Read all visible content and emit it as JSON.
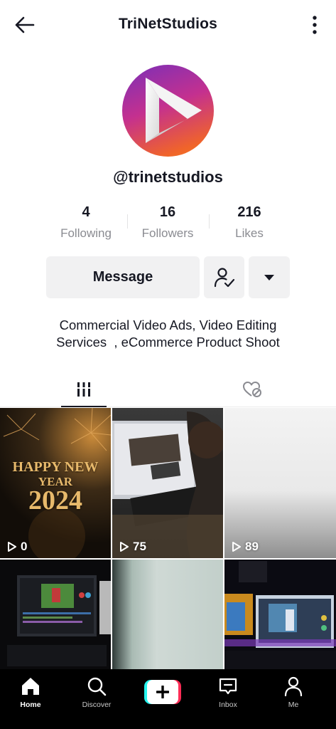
{
  "header": {
    "title": "TriNetStudios",
    "back_icon": "arrow-left-icon",
    "more_icon": "vertical-dots-icon"
  },
  "profile": {
    "handle": "@trinetstudios",
    "avatar_colors": [
      "#7a2fb8",
      "#c4308f",
      "#f0642a"
    ]
  },
  "stats": [
    {
      "value": "4",
      "label": "Following"
    },
    {
      "value": "16",
      "label": "Followers"
    },
    {
      "value": "216",
      "label": "Likes"
    }
  ],
  "actions": {
    "message_label": "Message",
    "follow_icon": "user-check-icon",
    "dropdown_icon": "caret-down-icon"
  },
  "bio": {
    "line1": "Commercial Video Ads, Video Editing",
    "line2": "Services  , eCommerce Product Shoot"
  },
  "tabs": [
    {
      "name": "videos",
      "icon": "grid-bars-icon",
      "active": true
    },
    {
      "name": "liked",
      "icon": "hidden-heart-icon",
      "active": false
    }
  ],
  "videos": [
    {
      "views": "0",
      "overlay_line1": "HAPPY NEW",
      "overlay_line2": "YEAR",
      "overlay_line3": "2024"
    },
    {
      "views": "75"
    },
    {
      "views": "89"
    },
    {
      "views": ""
    },
    {
      "views": ""
    },
    {
      "views": ""
    }
  ],
  "bottom_nav": [
    {
      "label": "Home",
      "icon": "home-icon",
      "active": true
    },
    {
      "label": "Discover",
      "icon": "search-icon",
      "active": false
    },
    {
      "label": "",
      "icon": "plus-icon",
      "active": false
    },
    {
      "label": "Inbox",
      "icon": "inbox-icon",
      "active": false
    },
    {
      "label": "Me",
      "icon": "person-icon",
      "active": false
    }
  ],
  "colors": {
    "accent_pink": "#fe2c55",
    "accent_cyan": "#25f4ee",
    "button_bg": "#f1f1f2",
    "secondary_text": "#8a8b91"
  }
}
